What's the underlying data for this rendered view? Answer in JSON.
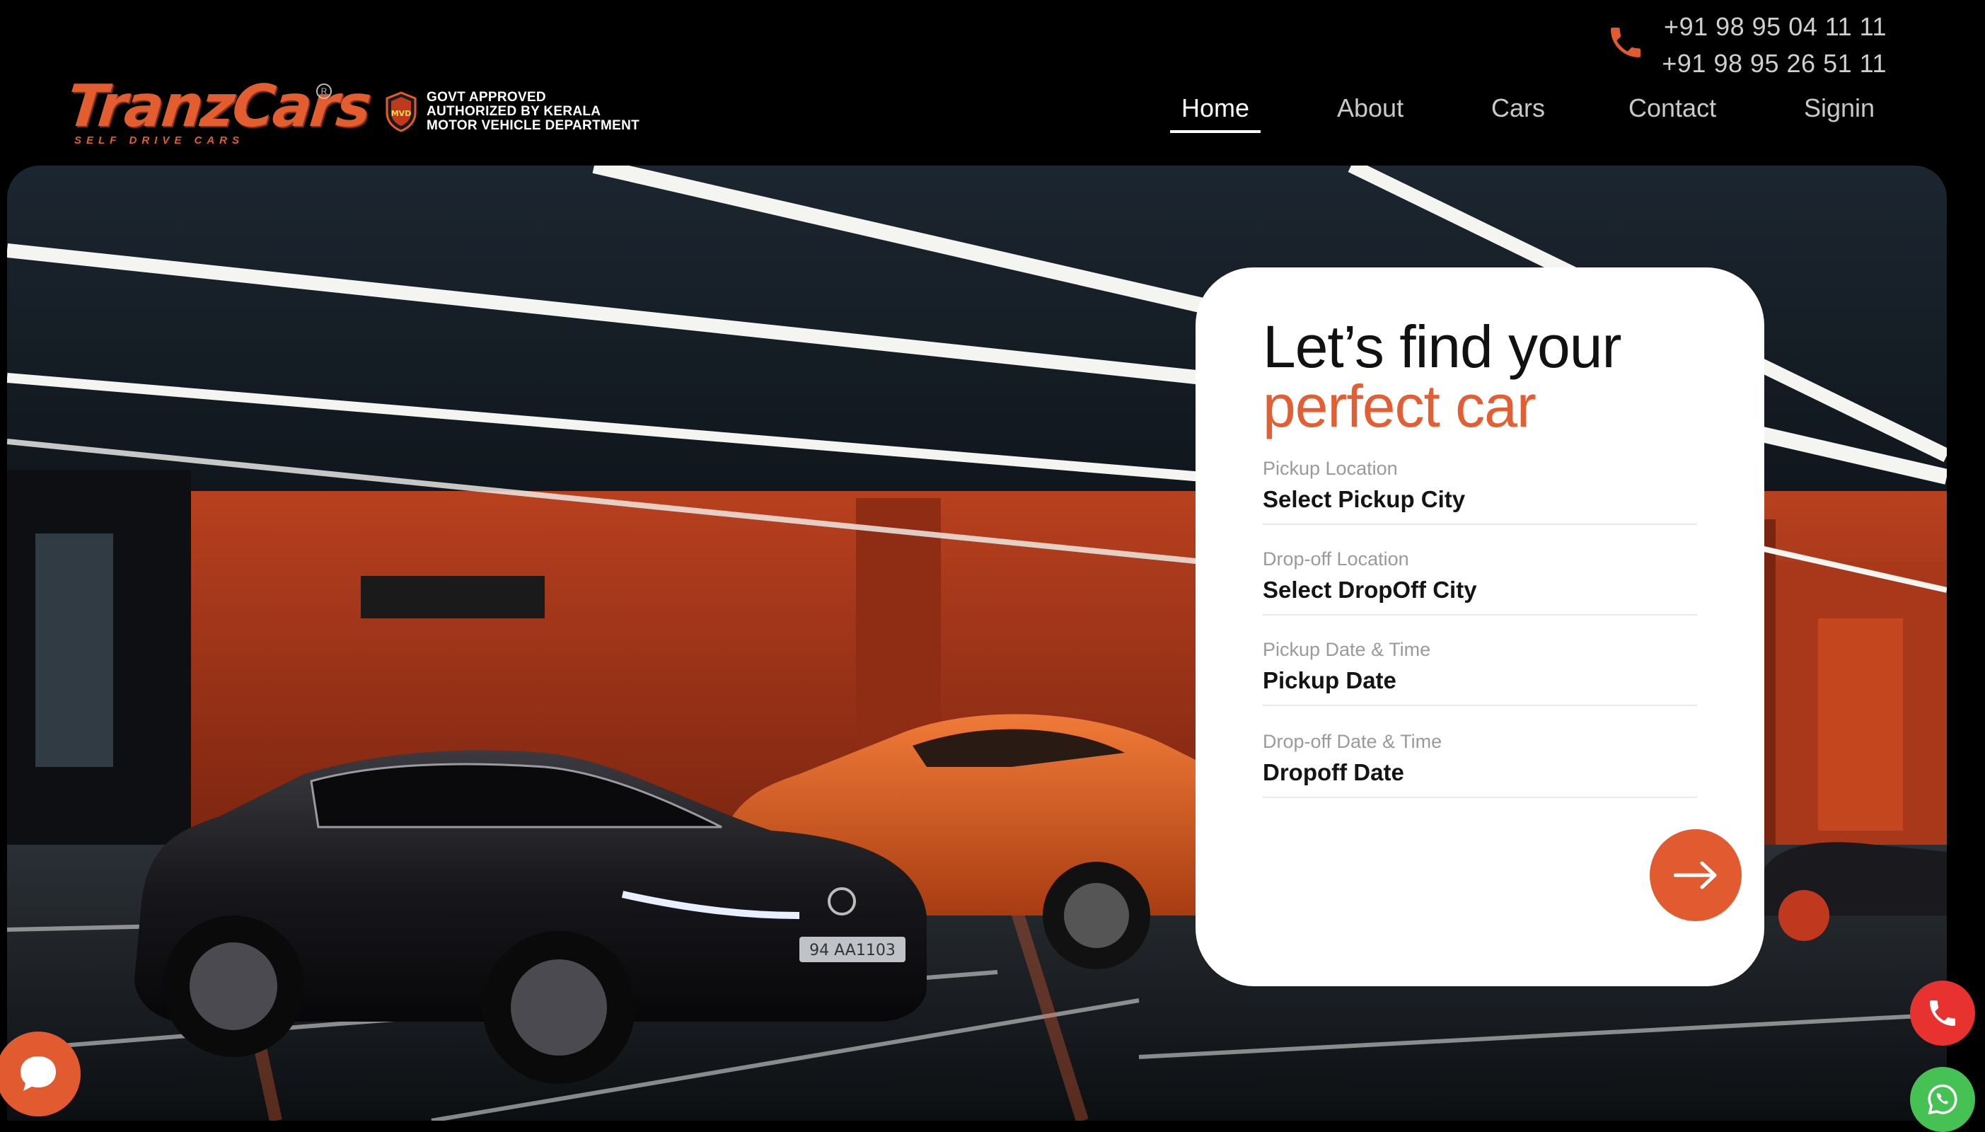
{
  "header": {
    "phones": [
      "+91 98 95 04 11 11",
      "+91 98 95 26 51 11"
    ],
    "logo": {
      "name": "TranzCars",
      "tagline": "SELF DRIVE CARS",
      "reg": "R"
    },
    "badge": {
      "lines": [
        "GOVT APPROVED",
        "AUTHORIZED BY KERALA",
        "MOTOR VEHICLE DEPARTMENT"
      ],
      "emblem": "MVD"
    },
    "nav": [
      {
        "label": "Home",
        "active": true
      },
      {
        "label": "About",
        "active": false
      },
      {
        "label": "Cars",
        "active": false
      },
      {
        "label": "Contact",
        "active": false
      },
      {
        "label": "Signin",
        "active": false
      }
    ]
  },
  "hero": {
    "plate": "94 AA1103"
  },
  "search_card": {
    "title_line1": "Let’s find your",
    "title_line2": "perfect car",
    "fields": [
      {
        "label": "Pickup Location",
        "value": "Select Pickup City"
      },
      {
        "label": "Drop-off Location",
        "value": "Select DropOff City"
      },
      {
        "label": "Pickup Date & Time",
        "value": "Pickup Date"
      },
      {
        "label": "Drop-off Date & Time",
        "value": "Dropoff Date"
      }
    ],
    "submit_icon": "arrow-right-icon"
  },
  "widgets": {
    "chat_icon": "chat-bubble-icon",
    "call_icon": "phone-icon",
    "whatsapp_icon": "whatsapp-icon"
  },
  "colors": {
    "accent": "#e25a2f",
    "call": "#e8322f",
    "whatsapp": "#46c154",
    "background": "#000000"
  }
}
